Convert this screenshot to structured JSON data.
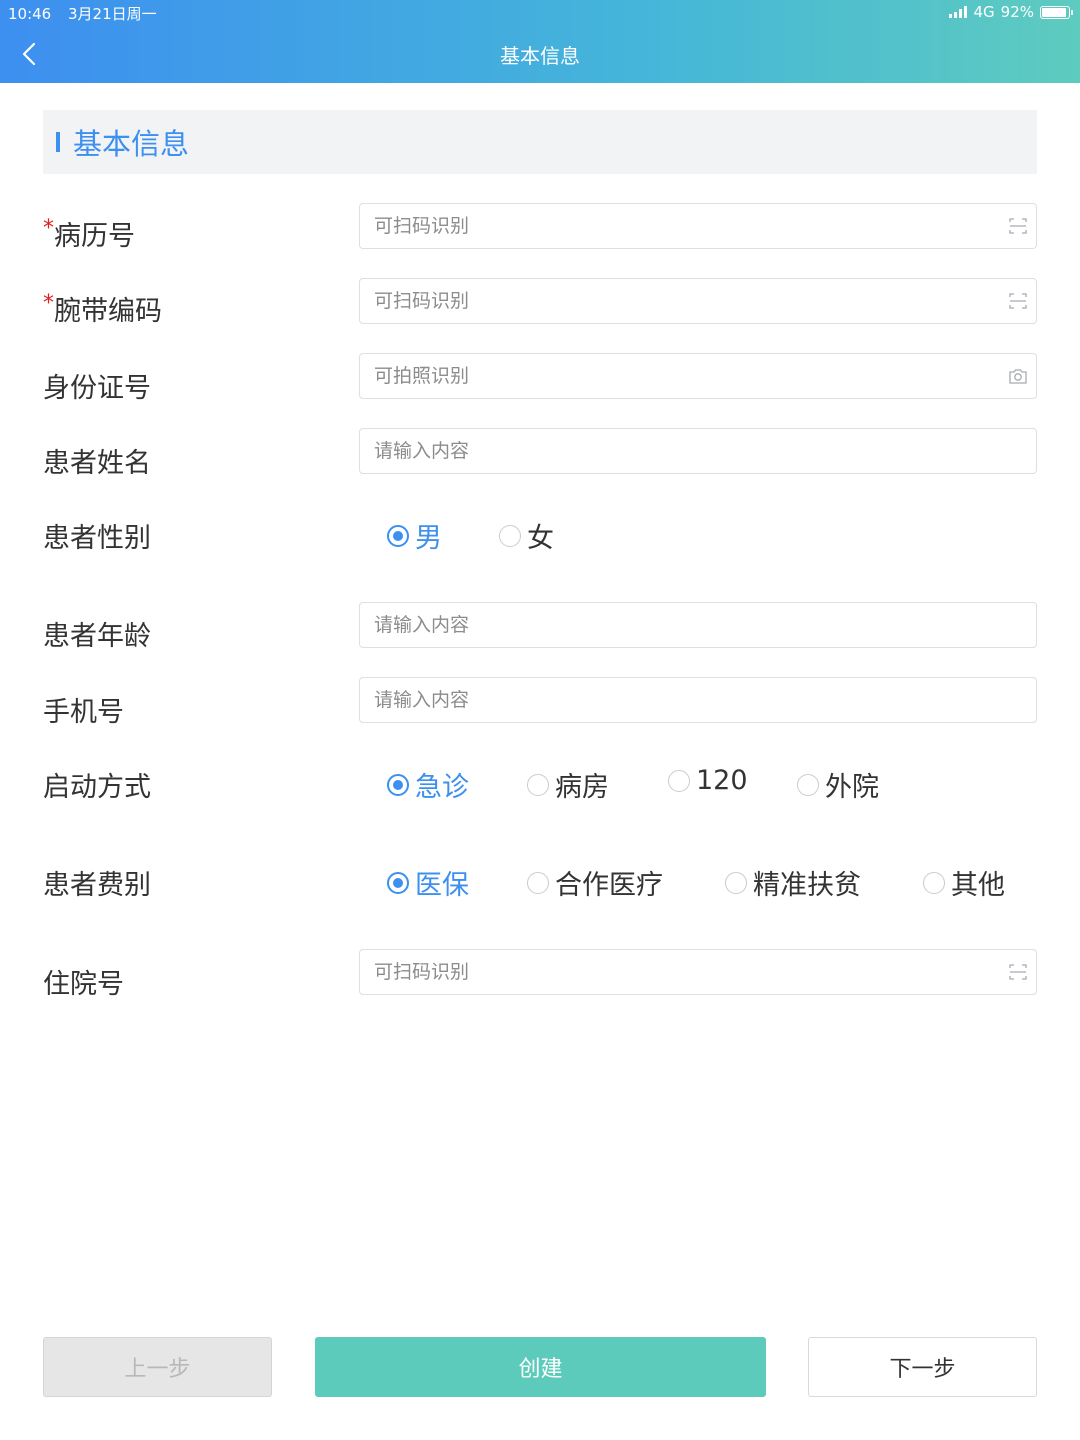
{
  "status_bar": {
    "time": "10:46",
    "date": "3月21日周一",
    "network": "4G",
    "battery": "92%",
    "battery_level": 0.92
  },
  "header": {
    "title": "基本信息"
  },
  "section": {
    "title": "基本信息"
  },
  "form": {
    "medical_record": {
      "label": "病历号",
      "required_mark": "*",
      "placeholder": "可扫码识别"
    },
    "wristband": {
      "label": "腕带编码",
      "required_mark": "*",
      "placeholder": "可扫码识别"
    },
    "id_number": {
      "label": "身份证号",
      "placeholder": "可拍照识别"
    },
    "patient_name": {
      "label": "患者姓名",
      "placeholder": "请输入内容"
    },
    "gender": {
      "label": "患者性别",
      "options": [
        "男",
        "女"
      ],
      "selected": "男"
    },
    "age": {
      "label": "患者年龄",
      "placeholder": "请输入内容"
    },
    "phone": {
      "label": "手机号",
      "placeholder": "请输入内容"
    },
    "start_mode": {
      "label": "启动方式",
      "options": [
        "急诊",
        "病房",
        "120",
        "外院"
      ],
      "selected": "急诊"
    },
    "fee_type": {
      "label": "患者费别",
      "options": [
        "医保",
        "合作医疗",
        "精准扶贫",
        "其他"
      ],
      "selected": "医保"
    },
    "inpatient_number": {
      "label": "住院号",
      "placeholder": "可扫码识别"
    }
  },
  "buttons": {
    "prev": "上一步",
    "create": "创建",
    "next": "下一步"
  },
  "colors": {
    "accent": "#3d8ff0",
    "create_button": "#5ccbbb",
    "required": "#e02020"
  }
}
